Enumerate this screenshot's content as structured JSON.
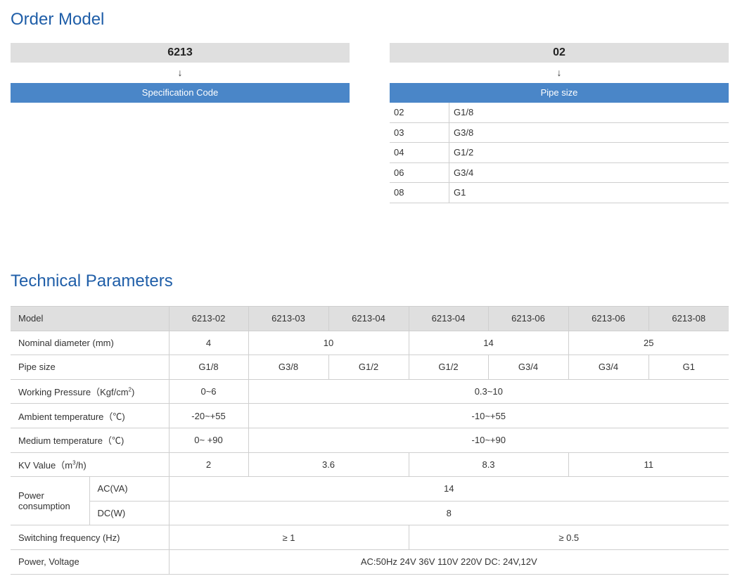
{
  "order_model": {
    "title": "Order Model",
    "left": {
      "code": "6213",
      "arrow": "↓",
      "label": "Specification Code"
    },
    "right": {
      "code": "02",
      "arrow": "↓",
      "label": "Pipe size",
      "options": [
        {
          "code": "02",
          "value": "G1/8"
        },
        {
          "code": "03",
          "value": "G3/8"
        },
        {
          "code": "04",
          "value": "G1/2"
        },
        {
          "code": "06",
          "value": "G3/4"
        },
        {
          "code": "08",
          "value": "G1"
        }
      ]
    }
  },
  "technical": {
    "title": "Technical Parameters",
    "model_label": "Model",
    "models": [
      "6213-02",
      "6213-03",
      "6213-04",
      "6213-04",
      "6213-06",
      "6213-06",
      "6213-08"
    ],
    "nominal_label": "Nominal diameter (mm)",
    "nominal": [
      "4",
      "10",
      "14",
      "25"
    ],
    "pipe_label": "Pipe size",
    "pipe": [
      "G1/8",
      "G3/8",
      "G1/2",
      "G1/2",
      "G3/4",
      "G3/4",
      "G1"
    ],
    "pressure_label": "Working Pressure（Kgf/cm",
    "pressure_sup": "2",
    "pressure_label_end": ")",
    "pressure": [
      "0~6",
      "0.3~10"
    ],
    "ambient_label": "Ambient temperature（℃)",
    "ambient": [
      "-20~+55",
      "-10~+55"
    ],
    "medium_label": "Medium temperature（℃)",
    "medium": [
      "0~ +90",
      "-10~+90"
    ],
    "kv_label": "KV Value（m",
    "kv_sup": "3",
    "kv_label_end": "/h)",
    "kv": [
      "2",
      "3.6",
      "8.3",
      "11"
    ],
    "power_label": "Power consumption",
    "ac_label": "AC(VA)",
    "ac": "14",
    "dc_label": "DC(W)",
    "dc": "8",
    "switching_label": "Switching frequency (Hz)",
    "switching": [
      "≥ 1",
      "≥ 0.5"
    ],
    "voltage_label": "Power, Voltage",
    "voltage": "AC:50Hz 24V 36V 110V 220V DC: 24V,12V"
  }
}
